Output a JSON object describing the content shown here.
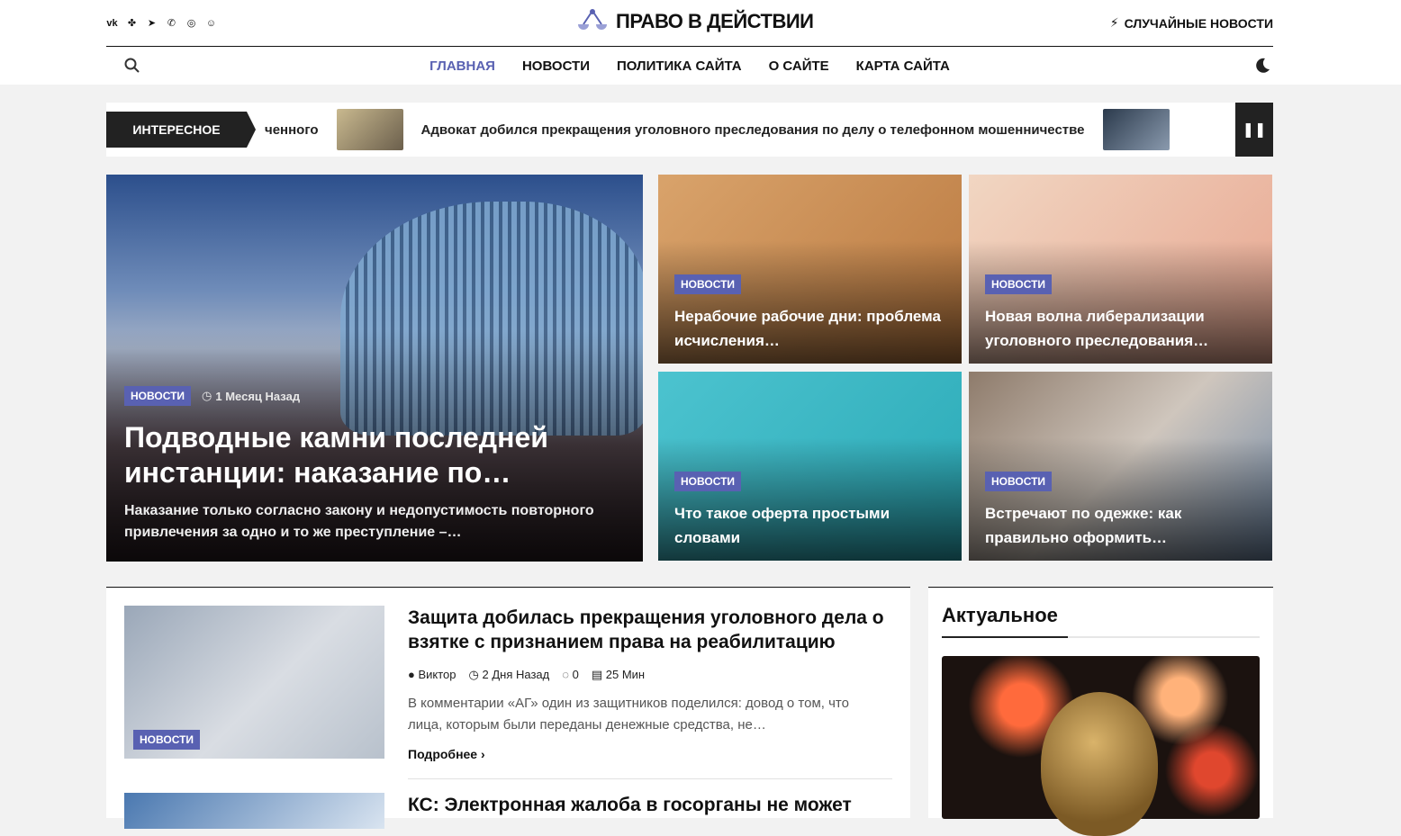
{
  "header": {
    "socials": [
      "vk",
      "ok",
      "tg",
      "viber",
      "wa",
      "msg"
    ],
    "logo_text": "ПРАВО В ДЕЙСТВИИ",
    "random_news": "СЛУЧАЙНЫЕ НОВОСТИ",
    "nav": [
      "ГЛАВНАЯ",
      "НОВОСТИ",
      "ПОЛИТИКА САЙТА",
      "О САЙТЕ",
      "КАРТА САЙТА"
    ],
    "active_nav": "ГЛАВНАЯ"
  },
  "ticker": {
    "label": "ИНТЕРЕСНОЕ",
    "item1": "ченного",
    "item2": "Адвокат добился прекращения уголовного преследования по делу о телефонном мошенничестве",
    "pause": "❚❚"
  },
  "hero": {
    "badge": "НОВОСТИ",
    "time": "1 Месяц Назад",
    "title": "Подводные камни последней инстанции: наказание по…",
    "excerpt": "Наказание только согласно закону и недопустимость повторного привлечения за одно и то же преступление –…"
  },
  "tiles": [
    {
      "badge": "НОВОСТИ",
      "title": "Нерабочие рабочие дни: проблема исчисления…"
    },
    {
      "badge": "НОВОСТИ",
      "title": "Новая волна либерализации уголовного преследования…"
    },
    {
      "badge": "НОВОСТИ",
      "title": "Что такое оферта простыми словами"
    },
    {
      "badge": "НОВОСТИ",
      "title": "Встречают по одежке: как правильно оформить…"
    }
  ],
  "posts": [
    {
      "badge": "НОВОСТИ",
      "title": "Защита добилась прекращения уголовного дела о взятке с признанием права на реабилитацию",
      "author": "Виктор",
      "time": "2 Дня Назад",
      "comments": "0",
      "read": "25 Мин",
      "excerpt": "В комментарии «АГ» один из защитников поделился: довод о том, что лица, которым были переданы денежные средства, не…",
      "more": "Подробнее"
    },
    {
      "title": "КС: Электронная жалоба в госорганы не может"
    }
  ],
  "sidebar": {
    "title": "Актуальное"
  }
}
